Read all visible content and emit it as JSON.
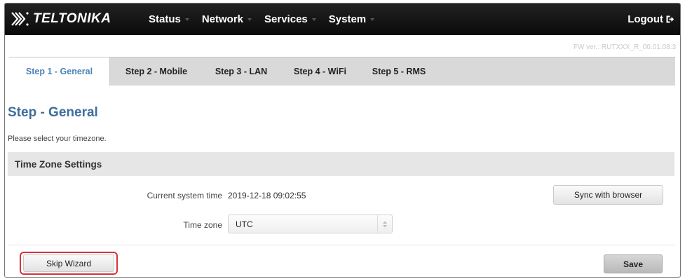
{
  "brand": {
    "name": "TELTONIKA",
    "logo_icon": "teltonika-logo-icon"
  },
  "nav": {
    "items": [
      {
        "label": "Status"
      },
      {
        "label": "Network"
      },
      {
        "label": "Services"
      },
      {
        "label": "System"
      }
    ],
    "logout_label": "Logout",
    "logout_icon": "logout-icon"
  },
  "firmware": {
    "text": "FW ver.: RUTXXX_R_00.01.08.3"
  },
  "wizard": {
    "tabs": [
      {
        "label": "Step 1 - General",
        "active": true
      },
      {
        "label": "Step 2 - Mobile",
        "active": false
      },
      {
        "label": "Step 3 - LAN",
        "active": false
      },
      {
        "label": "Step 4 - WiFi",
        "active": false
      },
      {
        "label": "Step 5 - RMS",
        "active": false
      }
    ],
    "title": "Step - General",
    "hint": "Please select your timezone."
  },
  "timezone_settings": {
    "header": "Time Zone Settings",
    "current_time_label": "Current system time",
    "current_time_value": "2019-12-18 09:02:55",
    "sync_button_label": "Sync with browser",
    "timezone_label": "Time zone",
    "timezone_value": "UTC"
  },
  "footer": {
    "skip_label": "Skip Wizard",
    "save_label": "Save"
  },
  "colors": {
    "navbar_bg": "#111111",
    "active_tab_text": "#4b82b7",
    "title_color": "#3f6e9e",
    "highlight_border": "#d4333a"
  }
}
